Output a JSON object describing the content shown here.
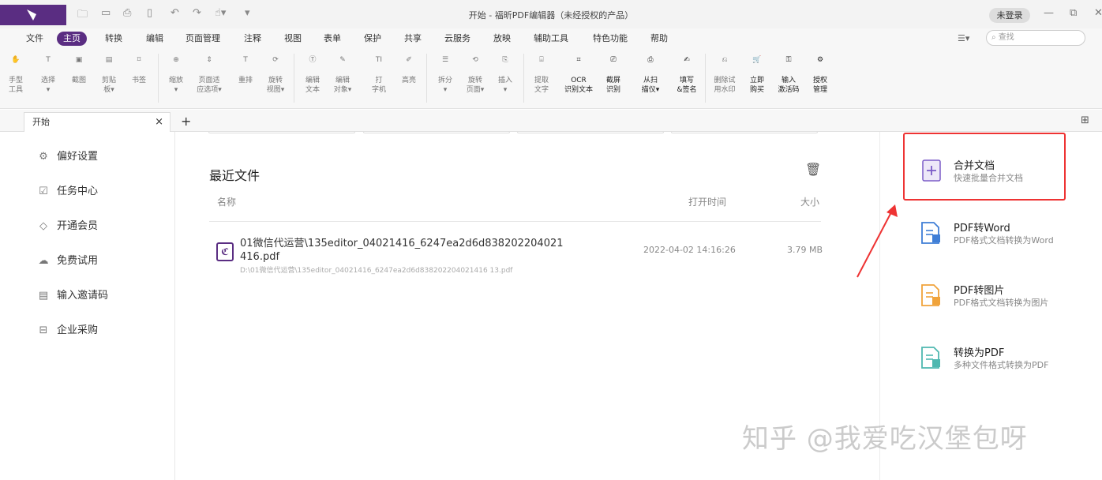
{
  "window": {
    "title": "开始 - 福昕PDF编辑器（未经授权的产品）",
    "login_label": "未登录"
  },
  "menu": [
    "文件",
    "主页",
    "转换",
    "编辑",
    "页面管理",
    "注释",
    "视图",
    "表单",
    "保护",
    "共享",
    "云服务",
    "放映",
    "辅助工具",
    "特色功能",
    "帮助"
  ],
  "search": {
    "placeholder": "查找"
  },
  "ribbon": [
    [
      "手型",
      "工具"
    ],
    [
      "选择",
      "▾"
    ],
    [
      "截图",
      ""
    ],
    [
      "剪贴",
      "板▾"
    ],
    [
      "书签",
      ""
    ],
    [
      "缩放",
      "▾"
    ],
    [
      "页面适",
      "应选项▾"
    ],
    [
      "重排",
      ""
    ],
    [
      "旋转",
      "视图▾"
    ],
    [
      "编辑",
      "文本"
    ],
    [
      "编辑",
      "对象▾"
    ],
    [
      "打",
      "字机"
    ],
    [
      "高亮",
      ""
    ],
    [
      "拆分",
      "▾"
    ],
    [
      "旋转",
      "页面▾"
    ],
    [
      "插入",
      "▾"
    ],
    [
      "提取",
      "文字"
    ],
    [
      "OCR",
      "识别文本"
    ],
    [
      "截屏",
      "识别"
    ],
    [
      "从扫",
      "描仪▾"
    ],
    [
      "填写",
      "&签名"
    ],
    [
      "删除试",
      "用水印"
    ],
    [
      "立即",
      "购买"
    ],
    [
      "输入",
      "激活码"
    ],
    [
      "授权",
      "管理"
    ]
  ],
  "tab": {
    "label": "开始",
    "close": "×",
    "add": "+"
  },
  "sidebar": [
    {
      "icon": "gear-icon",
      "label": "偏好设置"
    },
    {
      "icon": "task-icon",
      "label": "任务中心"
    },
    {
      "icon": "diamond-icon",
      "label": "开通会员"
    },
    {
      "icon": "cloud-icon",
      "label": "免费试用"
    },
    {
      "icon": "ticket-icon",
      "label": "输入邀请码"
    },
    {
      "icon": "cart-icon",
      "label": "企业采购"
    }
  ],
  "recent": {
    "title": "最近文件",
    "col_name": "名称",
    "col_time": "打开时间",
    "col_size": "大小",
    "files": [
      {
        "name": "01微信代运营\\135editor_04021416_6247ea2d6d838202204021416.pdf",
        "path": "D:\\01微信代运营\\135editor_04021416_6247ea2d6d838202204021416 13.pdf",
        "time": "2022-04-02 14:16:26",
        "size": "3.79 MB"
      }
    ]
  },
  "tools": [
    {
      "title": "合并文档",
      "subtitle": "快速批量合并文档",
      "color": "#7b5cc7"
    },
    {
      "title": "PDF转Word",
      "subtitle": "PDF格式文档转换为Word",
      "color": "#3f7ed6"
    },
    {
      "title": "PDF转图片",
      "subtitle": "PDF格式文档转换为图片",
      "color": "#f0a33b"
    },
    {
      "title": "转换为PDF",
      "subtitle": "多种文件格式转换为PDF",
      "color": "#4fb8b0"
    }
  ],
  "watermark": "知乎 @我爱吃汉堡包呀",
  "colors": {
    "brand": "#5a2d82",
    "highlight": "#e33333"
  }
}
